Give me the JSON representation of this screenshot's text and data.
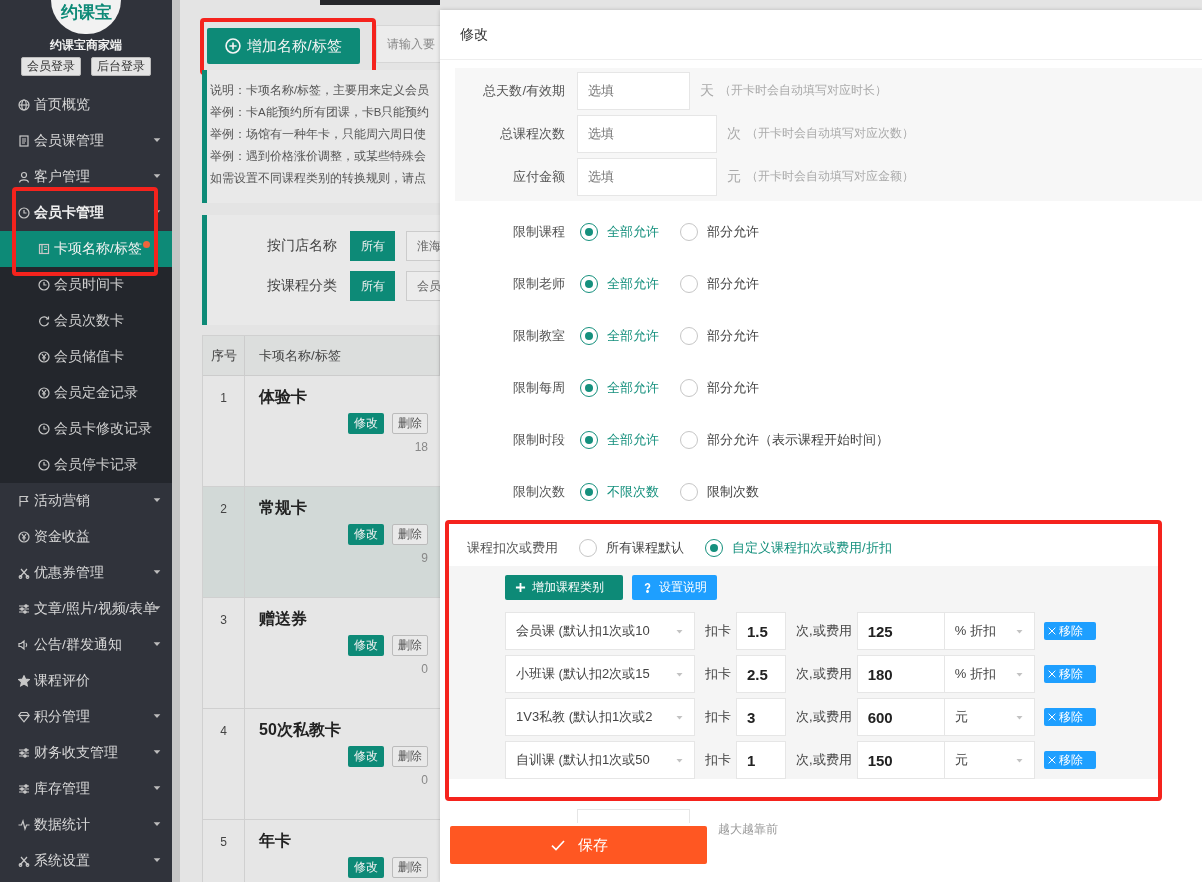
{
  "sidebar": {
    "logo_text": "约课宝",
    "brand": "约课宝商家端",
    "buttons": [
      "会员登录",
      "后台登录"
    ],
    "menu": [
      {
        "label": "首页概览",
        "expandable": false
      },
      {
        "label": "会员课管理",
        "expandable": true
      },
      {
        "label": "客户管理",
        "expandable": true
      },
      {
        "label": "会员卡管理",
        "expandable": true,
        "expanded": true,
        "highlighted": true,
        "children": [
          {
            "label": "卡项名称/标签",
            "selected": true,
            "dot": true
          },
          {
            "label": "会员时间卡",
            "selected": false,
            "dot": false
          },
          {
            "label": "会员次数卡",
            "selected": false,
            "dot": false
          },
          {
            "label": "会员储值卡",
            "selected": false,
            "dot": false
          },
          {
            "label": "会员定金记录",
            "selected": false,
            "dot": false
          },
          {
            "label": "会员卡修改记录",
            "selected": false,
            "dot": false
          },
          {
            "label": "会员停卡记录",
            "selected": false,
            "dot": false
          }
        ]
      },
      {
        "label": "活动营销",
        "expandable": true
      },
      {
        "label": "资金收益",
        "expandable": false
      },
      {
        "label": "优惠券管理",
        "expandable": true
      },
      {
        "label": "文章/照片/视频/表单",
        "expandable": true
      },
      {
        "label": "公告/群发通知",
        "expandable": true
      },
      {
        "label": "课程评价",
        "expandable": false
      },
      {
        "label": "积分管理",
        "expandable": true
      },
      {
        "label": "财务收支管理",
        "expandable": true
      },
      {
        "label": "库存管理",
        "expandable": true
      },
      {
        "label": "数据统计",
        "expandable": true
      },
      {
        "label": "系统设置",
        "expandable": true
      }
    ]
  },
  "page": {
    "add_button": {
      "label": "增加名称/标签",
      "highlighted": true
    },
    "search": {
      "placeholder": "请输入要"
    },
    "notes": [
      "说明：卡项名称/标签，主要用来定义会员",
      "举例：卡A能预约所有团课，卡B只能预约",
      "举例：场馆有一种年卡，只能周六周日使",
      "举例：遇到价格涨价调整，或某些特殊会",
      "如需设置不同课程类别的转换规则，请点"
    ],
    "filters": [
      {
        "label": "按门店名称",
        "options": [
          {
            "label": "所有",
            "selected": true
          },
          {
            "label": "淮海",
            "selected": false
          }
        ]
      },
      {
        "label": "按课程分类",
        "options": [
          {
            "label": "所有",
            "selected": true
          },
          {
            "label": "会员",
            "selected": false
          }
        ]
      }
    ],
    "table": {
      "columns": [
        "序号",
        "卡项名称/标签"
      ],
      "rows": [
        {
          "index": "1",
          "name": "体验卡",
          "edit": "修改",
          "delete": "删除",
          "count": "18",
          "hovered": false
        },
        {
          "index": "2",
          "name": "常规卡",
          "edit": "修改",
          "delete": "删除",
          "count": "9",
          "hovered": true
        },
        {
          "index": "3",
          "name": "赠送券",
          "edit": "修改",
          "delete": "删除",
          "count": "0",
          "hovered": false
        },
        {
          "index": "4",
          "name": "50次私教卡",
          "edit": "修改",
          "delete": "删除",
          "count": "0",
          "hovered": false
        },
        {
          "index": "5",
          "name": "年卡",
          "edit": "修改",
          "delete": "删除",
          "hovered": false
        }
      ]
    }
  },
  "modal": {
    "title": "修改",
    "number_fields": [
      {
        "label": "总天数/有效期",
        "placeholder": "选填",
        "unit": "天",
        "hint": "（开卡时会自动填写对应时长）"
      },
      {
        "label": "总课程次数",
        "placeholder": "选填",
        "unit": "次",
        "hint": "（开卡时会自动填写对应次数）"
      },
      {
        "label": "应付金额",
        "placeholder": "选填",
        "unit": "元",
        "hint": "（开卡时会自动填写对应金额）"
      }
    ],
    "restrictions": [
      {
        "label": "限制课程",
        "options": [
          {
            "label": "全部允许",
            "selected": true
          },
          {
            "label": "部分允许",
            "selected": false
          }
        ]
      },
      {
        "label": "限制老师",
        "options": [
          {
            "label": "全部允许",
            "selected": true
          },
          {
            "label": "部分允许",
            "selected": false
          }
        ]
      },
      {
        "label": "限制教室",
        "options": [
          {
            "label": "全部允许",
            "selected": true
          },
          {
            "label": "部分允许",
            "selected": false
          }
        ]
      },
      {
        "label": "限制每周",
        "options": [
          {
            "label": "全部允许",
            "selected": true
          },
          {
            "label": "部分允许",
            "selected": false
          }
        ]
      },
      {
        "label": "限制时段",
        "options": [
          {
            "label": "全部允许",
            "selected": true
          },
          {
            "label": "部分允许（表示课程开始时间）",
            "selected": false
          }
        ]
      },
      {
        "label": "限制次数",
        "options": [
          {
            "label": "不限次数",
            "selected": true
          },
          {
            "label": "限制次数",
            "selected": false
          }
        ]
      }
    ],
    "fee_section": {
      "highlighted": true,
      "label": "课程扣次或费用",
      "options": [
        {
          "label": "所有课程默认",
          "selected": false
        },
        {
          "label": "自定义课程扣次或费用/折扣",
          "selected": true
        }
      ],
      "buttons": [
        {
          "kind": "add",
          "label": "增加课程类别"
        },
        {
          "kind": "help",
          "label": "设置说明"
        }
      ],
      "rows": [
        {
          "course": "会员课 (默认扣1次或10",
          "deduct_label": "扣卡",
          "deduct": "1.5",
          "fee_label": "次,或费用",
          "fee": "125",
          "unit": "% 折扣",
          "remove": "移除"
        },
        {
          "course": "小班课 (默认扣2次或15",
          "deduct_label": "扣卡",
          "deduct": "2.5",
          "fee_label": "次,或费用",
          "fee": "180",
          "unit": "% 折扣",
          "remove": "移除"
        },
        {
          "course": "1V3私教 (默认扣1次或2",
          "deduct_label": "扣卡",
          "deduct": "3",
          "fee_label": "次,或费用",
          "fee": "600",
          "unit": "元",
          "remove": "移除"
        },
        {
          "course": "自训课 (默认扣1次或50",
          "deduct_label": "扣卡",
          "deduct": "1",
          "fee_label": "次,或费用",
          "fee": "150",
          "unit": "元",
          "remove": "移除"
        }
      ]
    },
    "sort_hint": "越大越靠前",
    "save_button": "保存"
  }
}
